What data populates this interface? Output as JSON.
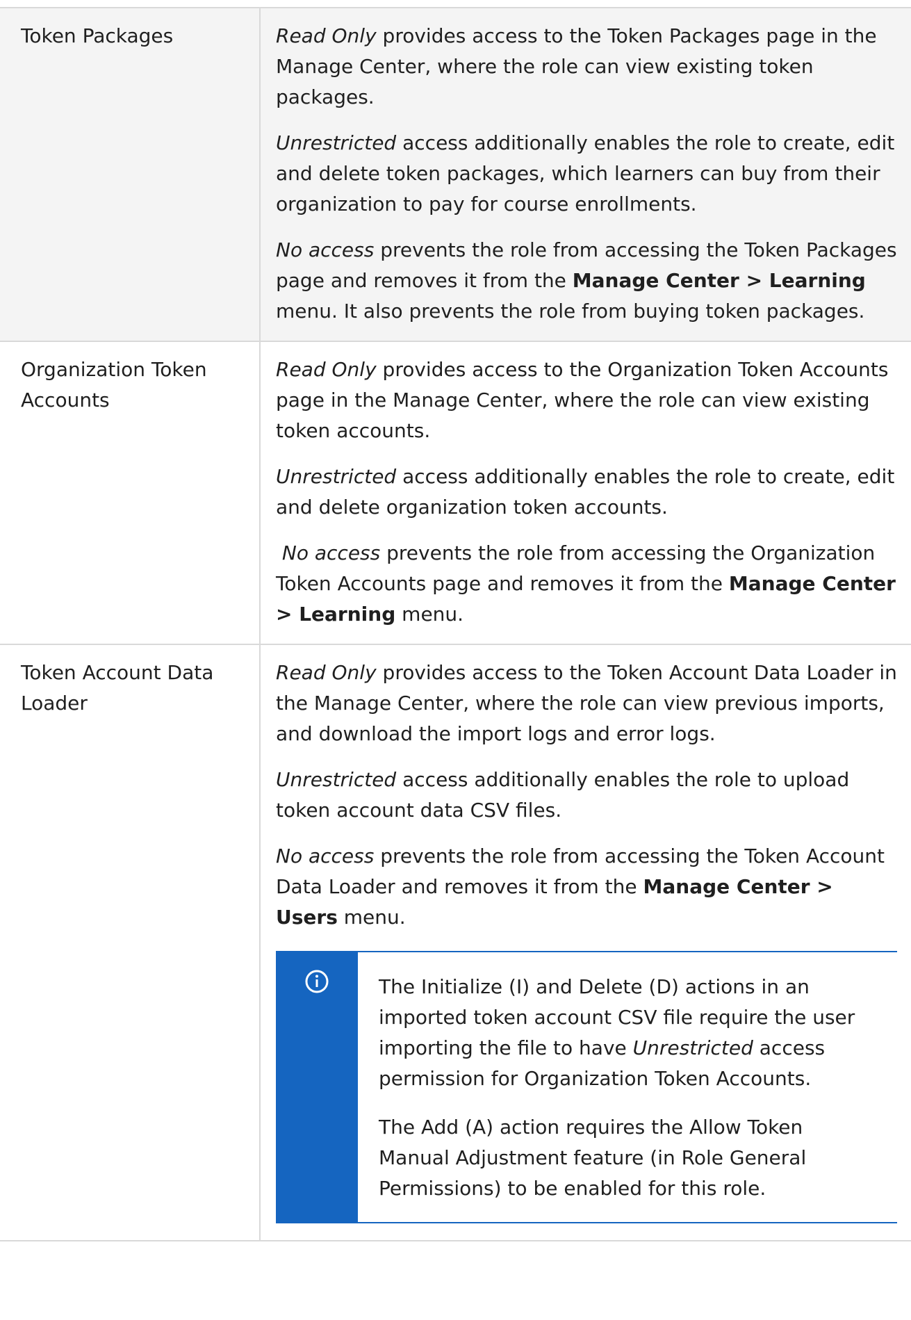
{
  "rows": [
    {
      "name": "Token Packages",
      "paragraphs": [
        {
          "lead": "Read Only",
          "text": " provides access to the Token Packages page in the Manage Center, where the role can view existing token packages."
        },
        {
          "lead": "Unrestricted",
          "text": " access additionally enables the role to create, edit and delete token packages, which learners can buy from their organization to pay for course enrollments."
        },
        {
          "lead": "No access",
          "text": " prevents the role from accessing the Token Packages page and removes it from the ",
          "bold": "Manage Center > Learning",
          "tail": " menu. It also prevents the role from buying token packages."
        }
      ]
    },
    {
      "name": "Organization Token Accounts",
      "paragraphs": [
        {
          "lead": "Read Only",
          "text": " provides access to the Organization Token Accounts page in the Manage Center, where the role can view existing token accounts."
        },
        {
          "lead": "Unrestricted",
          "text": " access additionally enables the role to create, edit and delete organization token accounts."
        },
        {
          "lead": "No access",
          "text": " prevents the role from accessing the Organization Token Accounts page and removes it from the ",
          "bold": "Manage Center > Learning",
          "tail": " menu."
        }
      ]
    },
    {
      "name": "Token Account Data Loader",
      "paragraphs": [
        {
          "lead": "Read Only",
          "text": " provides access to the Token Account Data Loader in the Manage Center, where the role can view previous imports, and download the import logs and error logs."
        },
        {
          "lead": "Unrestricted",
          "text": " access additionally enables the role to upload token account data CSV files."
        },
        {
          "lead": "No access",
          "text": " prevents the role from accessing the Token Account Data Loader and removes it from the ",
          "bold": "Manage Center > Users",
          "tail": " menu."
        }
      ],
      "note": {
        "icon": "info-icon",
        "p1_before": "The Initialize (I) and Delete (D) actions in an imported token account CSV file require the user importing the file to have ",
        "p1_em": "Unrestricted",
        "p1_after": " access permission for Organization Token Accounts.",
        "p2": "The Add (A) action requires the Allow Token Manual Adjustment feature (in Role General Permissions) to be enabled for this role."
      }
    }
  ],
  "colors": {
    "note_accent": "#1565c0",
    "row_shade": "#f4f4f4",
    "border": "#d9d9d9"
  }
}
